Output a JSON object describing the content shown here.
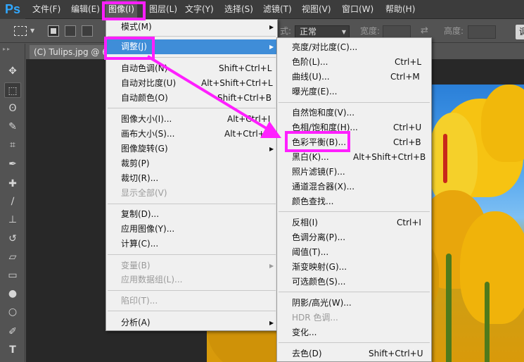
{
  "app": {
    "logo": "Ps"
  },
  "menubar": {
    "items": [
      "文件(F)",
      "编辑(E)",
      "图像(I)",
      "图层(L)",
      "文字(Y)",
      "选择(S)",
      "滤镜(T)",
      "视图(V)",
      "窗口(W)",
      "帮助(H)"
    ]
  },
  "options_bar": {
    "style_label": "式:",
    "style_value": "正常",
    "width_label": "宽度:",
    "height_label": "高度:",
    "button_label": "调"
  },
  "document": {
    "tab_label": "(C) Tulips.jpg @ 66"
  },
  "tools": [
    "move-tool",
    "marquee-tool",
    "lasso-tool",
    "quick-select-tool",
    "crop-tool",
    "eyedropper-tool",
    "healing-tool",
    "brush-tool",
    "stamp-tool",
    "history-brush-tool",
    "eraser-tool",
    "gradient-tool",
    "blur-tool",
    "dodge-tool",
    "pen-tool",
    "type-tool"
  ],
  "image_menu": {
    "items": [
      {
        "label": "模式(M)",
        "shortcut": "",
        "submenu": true
      },
      {
        "label": "调整(J)",
        "shortcut": "",
        "submenu": true,
        "highlighted": true
      },
      {
        "label": "自动色调(N)",
        "shortcut": "Shift+Ctrl+L"
      },
      {
        "label": "自动对比度(U)",
        "shortcut": "Alt+Shift+Ctrl+L"
      },
      {
        "label": "自动颜色(O)",
        "shortcut": "Shift+Ctrl+B"
      },
      {
        "label": "图像大小(I)...",
        "shortcut": "Alt+Ctrl+I"
      },
      {
        "label": "画布大小(S)...",
        "shortcut": "Alt+Ctrl+C"
      },
      {
        "label": "图像旋转(G)",
        "shortcut": "",
        "submenu": true
      },
      {
        "label": "裁剪(P)",
        "shortcut": ""
      },
      {
        "label": "裁切(R)...",
        "shortcut": ""
      },
      {
        "label": "显示全部(V)",
        "shortcut": "",
        "disabled": true
      },
      {
        "label": "复制(D)...",
        "shortcut": ""
      },
      {
        "label": "应用图像(Y)...",
        "shortcut": ""
      },
      {
        "label": "计算(C)...",
        "shortcut": ""
      },
      {
        "label": "变量(B)",
        "shortcut": "",
        "submenu": true,
        "disabled": true
      },
      {
        "label": "应用数据组(L)...",
        "shortcut": "",
        "disabled": true
      },
      {
        "label": "陷印(T)...",
        "shortcut": "",
        "disabled": true
      },
      {
        "label": "分析(A)",
        "shortcut": "",
        "submenu": true
      }
    ]
  },
  "adjust_menu": {
    "items": [
      {
        "label": "亮度/对比度(C)...",
        "shortcut": ""
      },
      {
        "label": "色阶(L)...",
        "shortcut": "Ctrl+L"
      },
      {
        "label": "曲线(U)...",
        "shortcut": "Ctrl+M"
      },
      {
        "label": "曝光度(E)...",
        "shortcut": ""
      },
      {
        "label": "自然饱和度(V)...",
        "shortcut": ""
      },
      {
        "label": "色相/饱和度(H)...",
        "shortcut": "Ctrl+U"
      },
      {
        "label": "色彩平衡(B)...",
        "shortcut": "Ctrl+B"
      },
      {
        "label": "黑白(K)...",
        "shortcut": "Alt+Shift+Ctrl+B"
      },
      {
        "label": "照片滤镜(F)...",
        "shortcut": ""
      },
      {
        "label": "通道混合器(X)...",
        "shortcut": ""
      },
      {
        "label": "颜色查找...",
        "shortcut": ""
      },
      {
        "label": "反相(I)",
        "shortcut": "Ctrl+I"
      },
      {
        "label": "色调分离(P)...",
        "shortcut": ""
      },
      {
        "label": "阈值(T)...",
        "shortcut": ""
      },
      {
        "label": "渐变映射(G)...",
        "shortcut": ""
      },
      {
        "label": "可选颜色(S)...",
        "shortcut": ""
      },
      {
        "label": "阴影/高光(W)...",
        "shortcut": ""
      },
      {
        "label": "HDR 色调...",
        "shortcut": "",
        "disabled": true
      },
      {
        "label": "变化...",
        "shortcut": ""
      },
      {
        "label": "去色(D)",
        "shortcut": "Shift+Ctrl+U"
      }
    ]
  },
  "colors": {
    "annotation": "#ff1fff",
    "menu_highlight": "#3f8dd8",
    "ps_blue": "#31a8ff"
  },
  "icons": {
    "submenu_arrow": "▶",
    "select_caret": "▼",
    "swap": "⇄"
  }
}
